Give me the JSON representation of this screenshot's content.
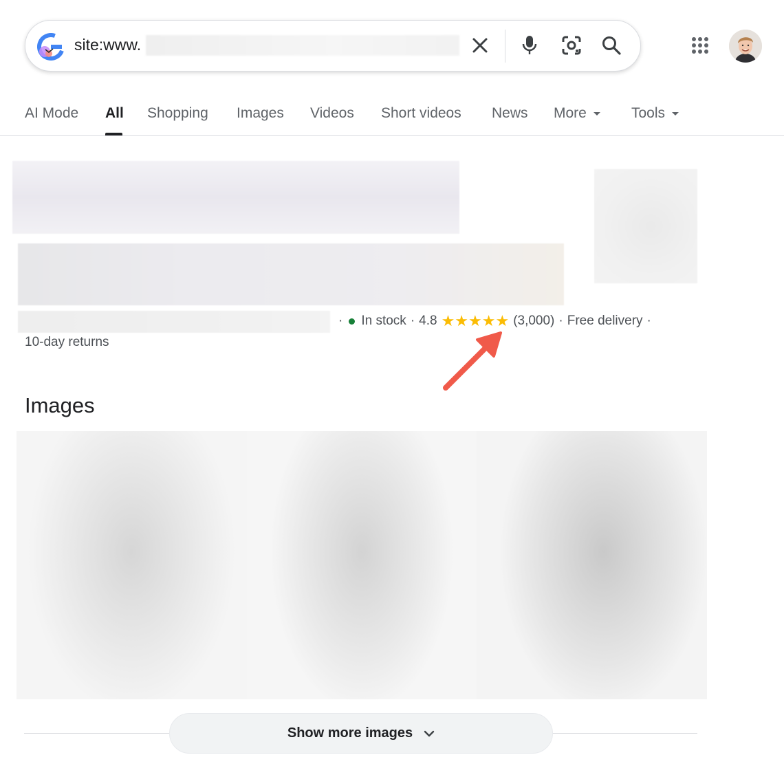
{
  "search": {
    "query_text": "site:www."
  },
  "tabs": [
    {
      "label": "AI Mode"
    },
    {
      "label": "All",
      "active": true
    },
    {
      "label": "Shopping"
    },
    {
      "label": "Images"
    },
    {
      "label": "Videos"
    },
    {
      "label": "Short videos"
    },
    {
      "label": "News"
    },
    {
      "label": "More",
      "dropdown": true
    },
    {
      "label": "Tools",
      "dropdown": true
    }
  ],
  "result": {
    "separator": "·",
    "stock_status": "In stock",
    "rating": "4.8",
    "stars": "★★★★★",
    "review_count": "(3,000)",
    "delivery": "Free delivery",
    "returns": "10-day returns"
  },
  "images_section": {
    "heading": "Images",
    "show_more_label": "Show more images"
  },
  "colors": {
    "accent_blue": "#4285f4",
    "star_yellow": "#fbbc04",
    "in_stock_green": "#188038",
    "annotation_arrow": "#f05a4a"
  },
  "icons": [
    "google-g-icon",
    "close-icon",
    "microphone-icon",
    "camera-lens-icon",
    "search-icon",
    "apps-grid-icon",
    "chevron-down-icon",
    "caret-down-icon"
  ]
}
